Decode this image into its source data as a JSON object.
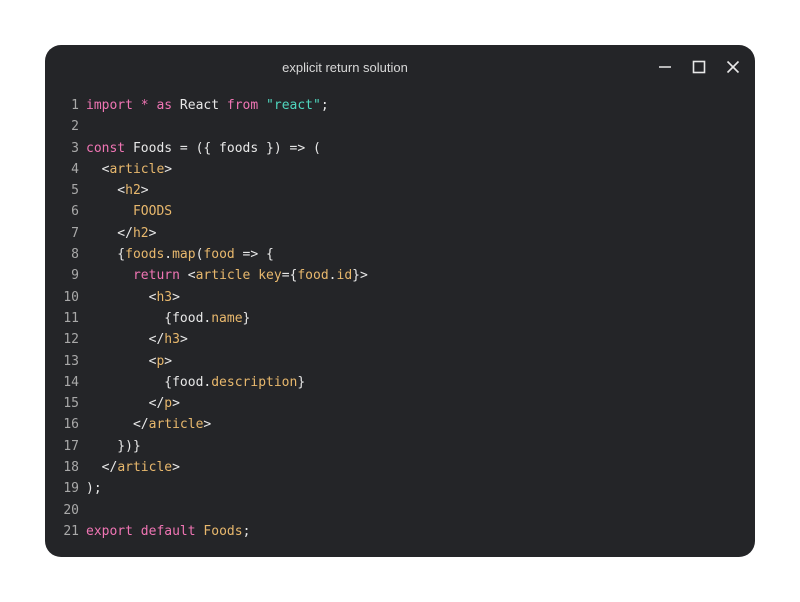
{
  "window": {
    "title": "explicit return solution",
    "controls": {
      "minimize_icon": "minimize-icon",
      "maximize_icon": "maximize-icon",
      "close_icon": "close-icon"
    }
  },
  "colors": {
    "background": "#242528",
    "keyword": "#f075b4",
    "string": "#4fd6be",
    "tag": "#e8b86d",
    "plain": "#e8e8e8",
    "line_number": "#a9a9a9"
  },
  "code": [
    {
      "n": "1",
      "tokens": [
        {
          "t": "kw",
          "v": "import"
        },
        {
          "t": "plain",
          "v": " "
        },
        {
          "t": "kw",
          "v": "*"
        },
        {
          "t": "plain",
          "v": " "
        },
        {
          "t": "kw",
          "v": "as"
        },
        {
          "t": "plain",
          "v": " React "
        },
        {
          "t": "kw",
          "v": "from"
        },
        {
          "t": "plain",
          "v": " "
        },
        {
          "t": "str",
          "v": "\"react\""
        },
        {
          "t": "plain",
          "v": ";"
        }
      ]
    },
    {
      "n": "2",
      "tokens": []
    },
    {
      "n": "3",
      "tokens": [
        {
          "t": "kw",
          "v": "const"
        },
        {
          "t": "plain",
          "v": " Foods = ({ foods }) => ("
        }
      ]
    },
    {
      "n": "4",
      "tokens": [
        {
          "t": "plain",
          "v": "  <"
        },
        {
          "t": "tag",
          "v": "article"
        },
        {
          "t": "plain",
          "v": ">"
        }
      ]
    },
    {
      "n": "5",
      "tokens": [
        {
          "t": "plain",
          "v": "    <"
        },
        {
          "t": "tag",
          "v": "h2"
        },
        {
          "t": "plain",
          "v": ">"
        }
      ]
    },
    {
      "n": "6",
      "tokens": [
        {
          "t": "tag",
          "v": "      FOODS"
        }
      ]
    },
    {
      "n": "7",
      "tokens": [
        {
          "t": "plain",
          "v": "    </"
        },
        {
          "t": "tag",
          "v": "h2"
        },
        {
          "t": "plain",
          "v": ">"
        }
      ]
    },
    {
      "n": "8",
      "tokens": [
        {
          "t": "plain",
          "v": "    {"
        },
        {
          "t": "tag",
          "v": "foods"
        },
        {
          "t": "plain",
          "v": "."
        },
        {
          "t": "tag",
          "v": "map"
        },
        {
          "t": "plain",
          "v": "("
        },
        {
          "t": "tag",
          "v": "food"
        },
        {
          "t": "plain",
          "v": " => {"
        }
      ]
    },
    {
      "n": "9",
      "tokens": [
        {
          "t": "plain",
          "v": "      "
        },
        {
          "t": "kw",
          "v": "return"
        },
        {
          "t": "plain",
          "v": " <"
        },
        {
          "t": "tag",
          "v": "article"
        },
        {
          "t": "plain",
          "v": " "
        },
        {
          "t": "tag",
          "v": "key"
        },
        {
          "t": "plain",
          "v": "={"
        },
        {
          "t": "tag",
          "v": "food"
        },
        {
          "t": "plain",
          "v": "."
        },
        {
          "t": "tag",
          "v": "id"
        },
        {
          "t": "plain",
          "v": "}>"
        }
      ]
    },
    {
      "n": "10",
      "tokens": [
        {
          "t": "plain",
          "v": "        <"
        },
        {
          "t": "tag",
          "v": "h3"
        },
        {
          "t": "plain",
          "v": ">"
        }
      ]
    },
    {
      "n": "11",
      "tokens": [
        {
          "t": "plain",
          "v": "          {food."
        },
        {
          "t": "tag",
          "v": "name"
        },
        {
          "t": "plain",
          "v": "}"
        }
      ]
    },
    {
      "n": "12",
      "tokens": [
        {
          "t": "plain",
          "v": "        </"
        },
        {
          "t": "tag",
          "v": "h3"
        },
        {
          "t": "plain",
          "v": ">"
        }
      ]
    },
    {
      "n": "13",
      "tokens": [
        {
          "t": "plain",
          "v": "        <"
        },
        {
          "t": "tag",
          "v": "p"
        },
        {
          "t": "plain",
          "v": ">"
        }
      ]
    },
    {
      "n": "14",
      "tokens": [
        {
          "t": "plain",
          "v": "          {food."
        },
        {
          "t": "tag",
          "v": "description"
        },
        {
          "t": "plain",
          "v": "}"
        }
      ]
    },
    {
      "n": "15",
      "tokens": [
        {
          "t": "plain",
          "v": "        </"
        },
        {
          "t": "tag",
          "v": "p"
        },
        {
          "t": "plain",
          "v": ">"
        }
      ]
    },
    {
      "n": "16",
      "tokens": [
        {
          "t": "plain",
          "v": "      </"
        },
        {
          "t": "tag",
          "v": "article"
        },
        {
          "t": "plain",
          "v": ">"
        }
      ]
    },
    {
      "n": "17",
      "tokens": [
        {
          "t": "plain",
          "v": "    })}"
        }
      ]
    },
    {
      "n": "18",
      "tokens": [
        {
          "t": "plain",
          "v": "  </"
        },
        {
          "t": "tag",
          "v": "article"
        },
        {
          "t": "plain",
          "v": ">"
        }
      ]
    },
    {
      "n": "19",
      "tokens": [
        {
          "t": "plain",
          "v": ");"
        }
      ]
    },
    {
      "n": "20",
      "tokens": []
    },
    {
      "n": "21",
      "tokens": [
        {
          "t": "kw",
          "v": "export"
        },
        {
          "t": "plain",
          "v": " "
        },
        {
          "t": "kw",
          "v": "default"
        },
        {
          "t": "plain",
          "v": " "
        },
        {
          "t": "tag",
          "v": "Foods"
        },
        {
          "t": "plain",
          "v": ";"
        }
      ]
    }
  ]
}
